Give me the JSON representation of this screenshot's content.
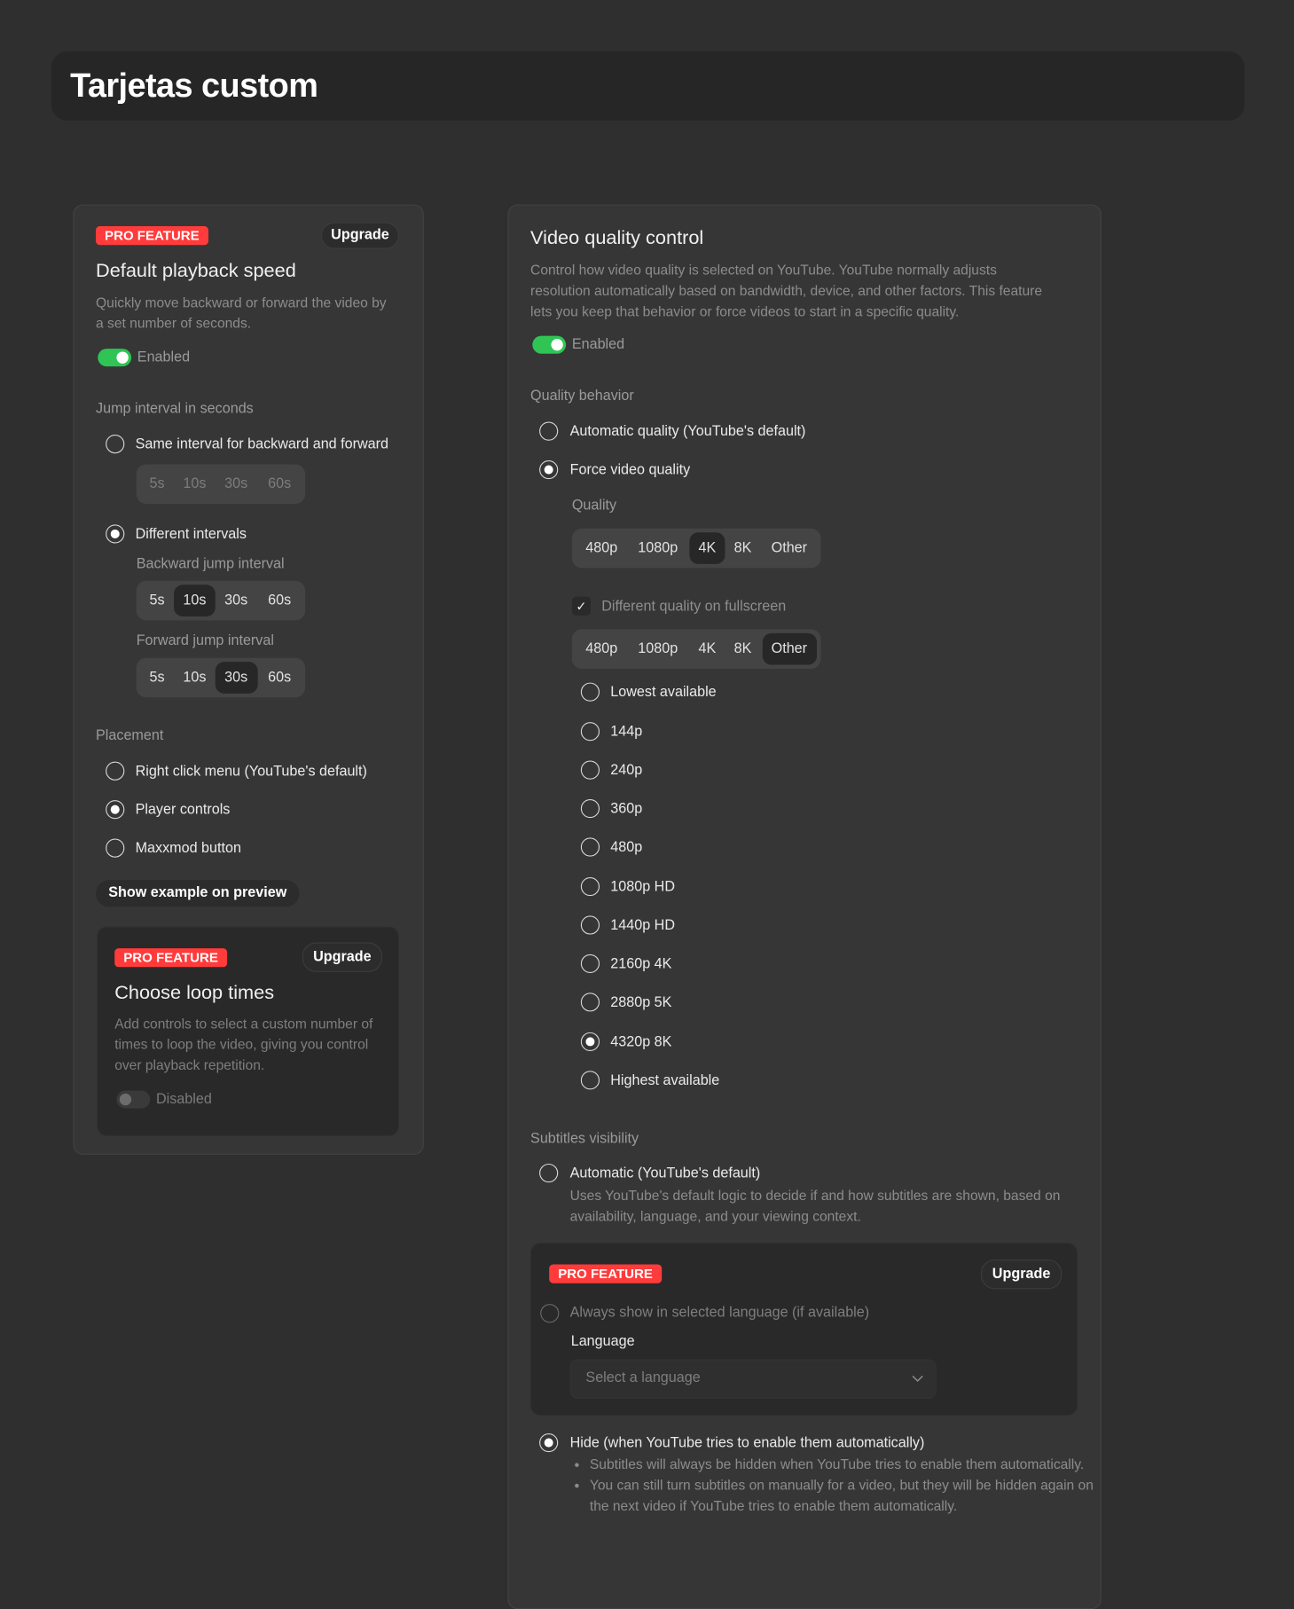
{
  "header": {
    "title": "Tarjetas custom"
  },
  "colors": {
    "pro_badge": "#ff3b3b",
    "toggle_on": "#2fc454",
    "page_bg": "#2f2f2f",
    "card_bg": "#363636"
  },
  "playback": {
    "badge": "PRO FEATURE",
    "upgrade": "Upgrade",
    "title": "Default playback speed",
    "desc": "Quickly move backward or forward the video by a set number of seconds.",
    "toggle_label": "Enabled",
    "enabled": true,
    "jump_label": "Jump interval in seconds",
    "same_interval": "Same interval for backward and forward",
    "different_intervals": "Different intervals",
    "intervals": [
      "5s",
      "10s",
      "30s",
      "60s"
    ],
    "backward_label": "Backward jump interval",
    "backward_selected": "10s",
    "forward_label": "Forward jump interval",
    "forward_selected": "30s",
    "placement_label": "Placement",
    "placement": [
      "Right click menu (YouTube's default)",
      "Player controls",
      "Maxxmod button"
    ],
    "placement_selected": "Player controls",
    "show_example": "Show example on preview"
  },
  "loop": {
    "badge": "PRO FEATURE",
    "upgrade": "Upgrade",
    "title": "Choose loop times",
    "desc": "Add controls to select a custom number of times to loop the video, giving you control over playback repetition.",
    "toggle_label": "Disabled",
    "enabled": false
  },
  "quality": {
    "title": "Video quality control",
    "desc": "Control how video quality is selected on YouTube. YouTube normally adjusts resolution automatically based on bandwidth, device, and other factors. This feature lets you keep that behavior or force videos to start in a specific quality.",
    "toggle_label": "Enabled",
    "enabled": true,
    "behavior_label": "Quality behavior",
    "behavior": [
      "Automatic quality (YouTube's default)",
      "Force video quality"
    ],
    "behavior_selected": "Force video quality",
    "quality_label": "Quality",
    "options": [
      "480p",
      "1080p",
      "4K",
      "8K",
      "Other"
    ],
    "selected": "4K",
    "fullscreen_label": "Different quality on fullscreen",
    "fullscreen_checked": true,
    "fullscreen_selected": "Other",
    "other_options": [
      "Lowest available",
      "144p",
      "240p",
      "360p",
      "480p",
      "1080p HD",
      "1440p HD",
      "2160p 4K",
      "2880p 5K",
      "4320p 8K",
      "Highest available"
    ],
    "other_selected": "4320p 8K"
  },
  "subtitles": {
    "label": "Subtitles visibility",
    "automatic": "Automatic (YouTube's default)",
    "automatic_desc": "Uses YouTube's default logic to decide if and how subtitles are shown, based on availability, language, and your viewing context.",
    "pro_badge": "PRO FEATURE",
    "upgrade": "Upgrade",
    "always": "Always show in selected language (if available)",
    "language_label": "Language",
    "language_placeholder": "Select a language",
    "hide": "Hide (when YouTube tries to enable them automatically)",
    "hide_bullets": [
      "Subtitles will always be hidden when YouTube tries to enable them automatically.",
      "You can still turn subtitles on manually for a video, but they will be hidden again on the next video if YouTube tries to enable them automatically."
    ],
    "selected": "hide"
  }
}
